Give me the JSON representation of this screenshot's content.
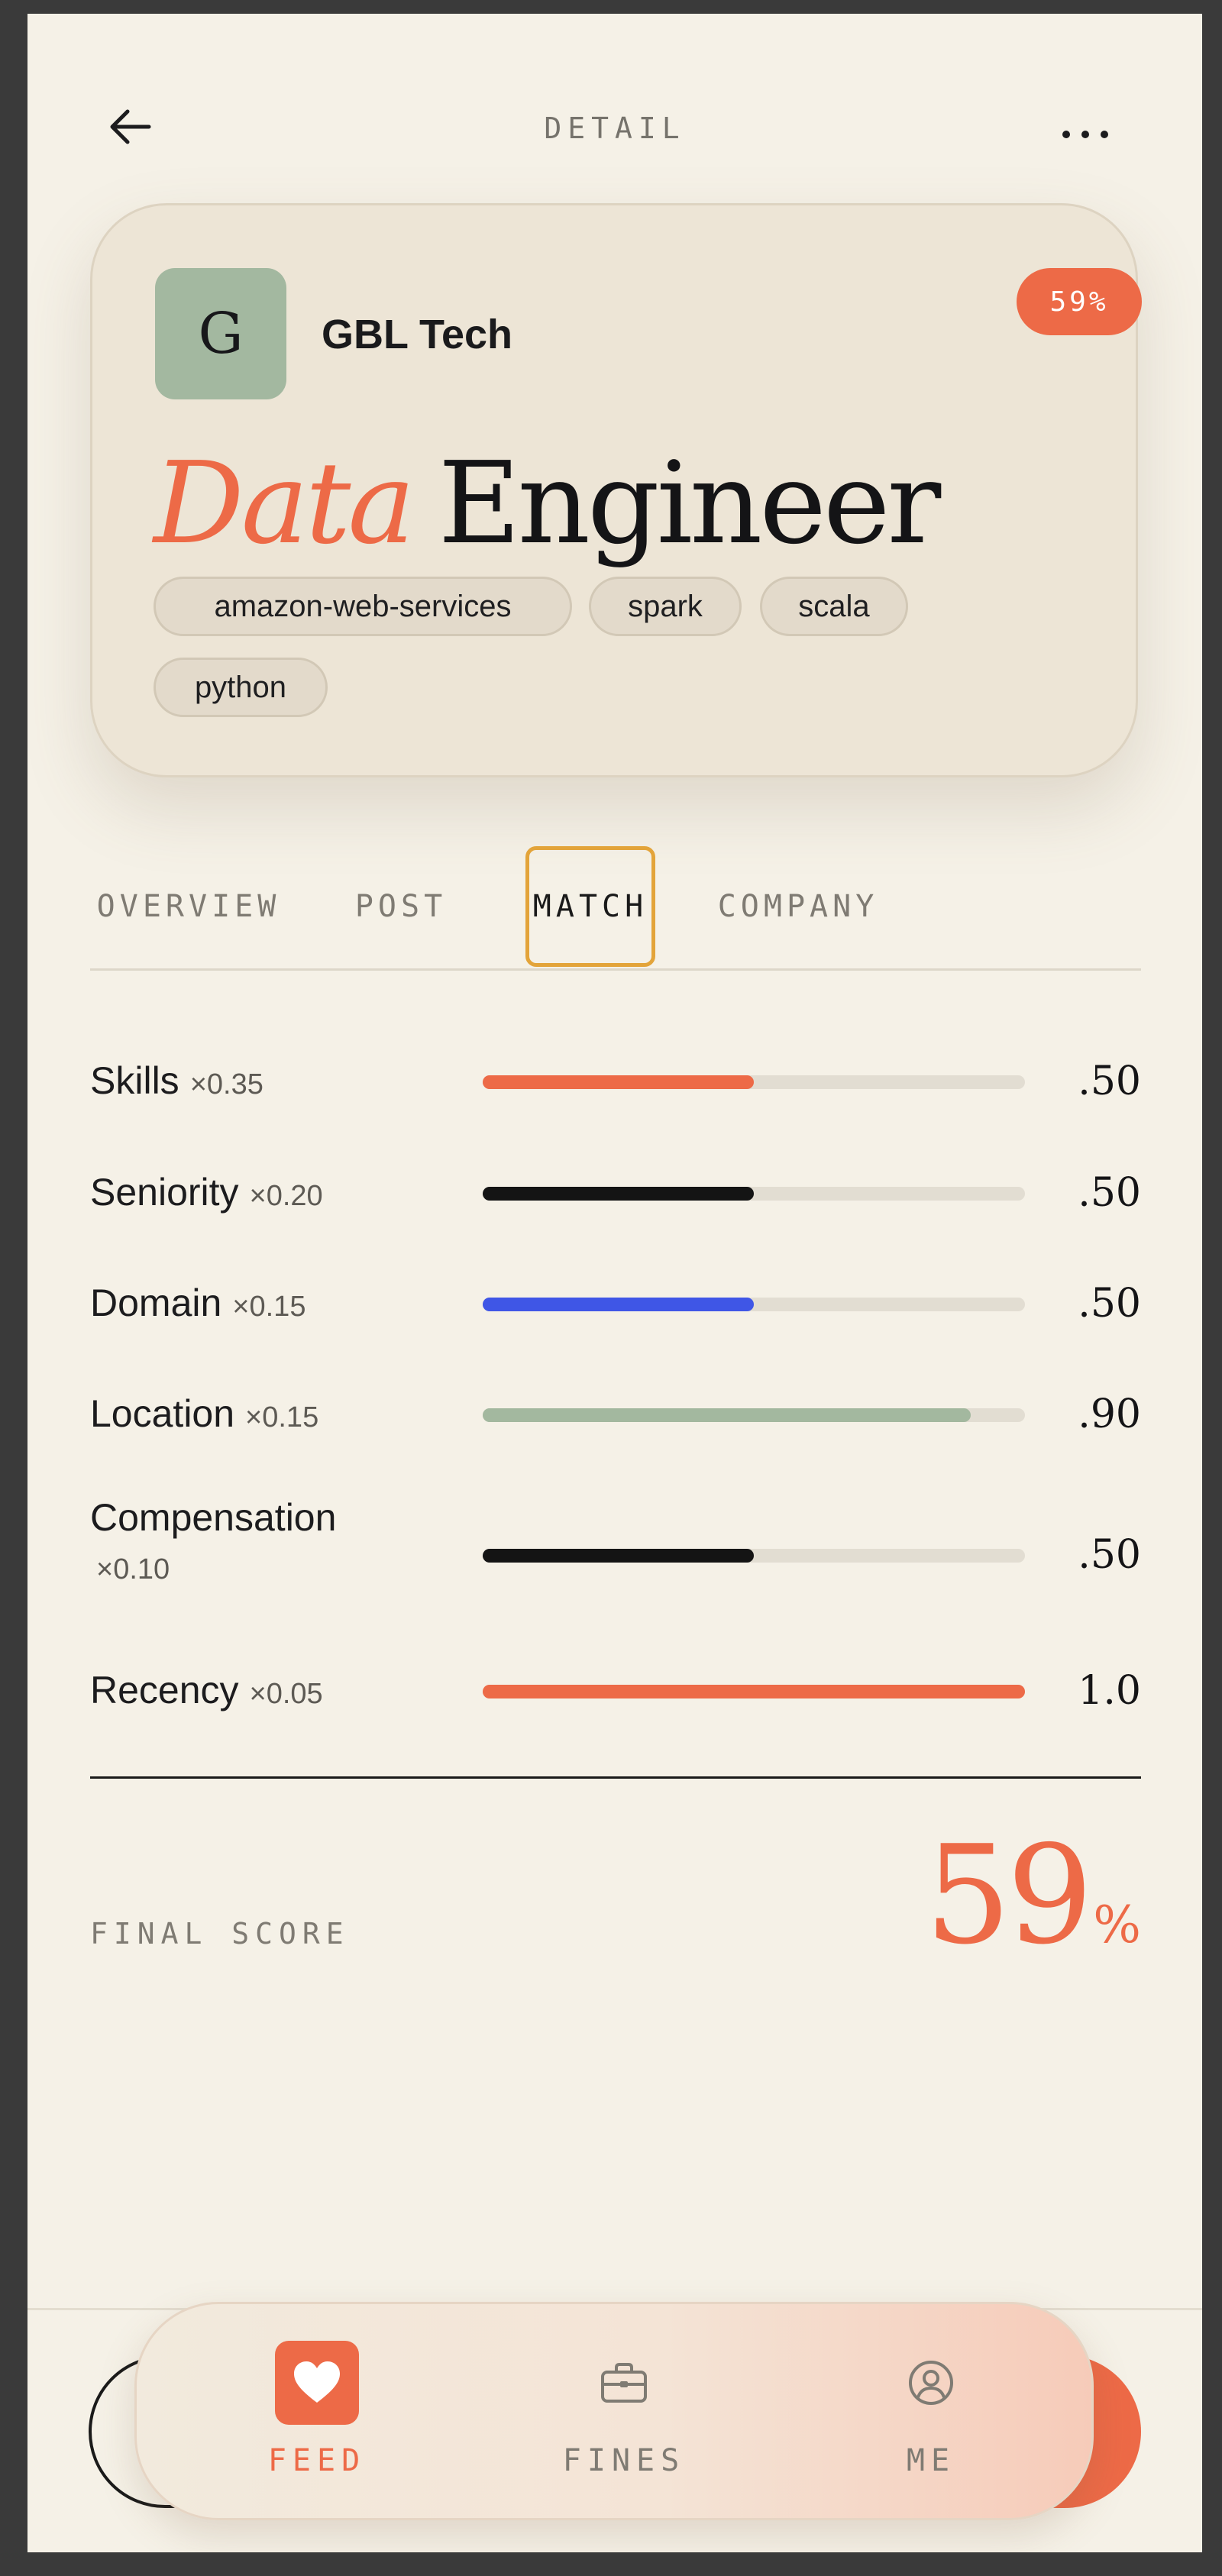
{
  "header": {
    "title": "DETAIL",
    "back_icon": "arrow-left-icon",
    "more_icon": "more-horizontal-icon"
  },
  "job": {
    "company_initial": "G",
    "company": "GBL Tech",
    "score_badge": "59%",
    "title_accent": "Data",
    "title_rest": "Engineer",
    "tags": [
      "amazon-web-services",
      "spark",
      "scala",
      "python"
    ]
  },
  "tabs": [
    {
      "label": "OVERVIEW",
      "active": false
    },
    {
      "label": "POST",
      "active": false
    },
    {
      "label": "MATCH",
      "active": true
    },
    {
      "label": "COMPANY",
      "active": false
    }
  ],
  "match": {
    "metrics": [
      {
        "name": "Skills",
        "weight": "×0.35",
        "value": ".50",
        "fill": 0.5,
        "color": "#ed6a47"
      },
      {
        "name": "Seniority",
        "weight": "×0.20",
        "value": ".50",
        "fill": 0.5,
        "color": "#141414"
      },
      {
        "name": "Domain",
        "weight": "×0.15",
        "value": ".50",
        "fill": 0.5,
        "color": "#3f56e6"
      },
      {
        "name": "Location",
        "weight": "×0.15",
        "value": ".90",
        "fill": 0.9,
        "color": "#a3b89f"
      },
      {
        "name": "Compensation",
        "weight": "×0.10",
        "value": ".50",
        "fill": 0.5,
        "color": "#141414"
      },
      {
        "name": "Recency",
        "weight": "×0.05",
        "value": "1.0",
        "fill": 1.0,
        "color": "#ed6a47"
      }
    ],
    "final_label": "FINAL SCORE",
    "final_score": "59",
    "final_unit": "%"
  },
  "colors": {
    "accent": "#ed6a47",
    "background": "#f5f1e7",
    "card": "#ede5d6",
    "logo": "#a3b8a0",
    "tab_focus": "#e3a43a"
  },
  "nav": [
    {
      "label": "FEED",
      "icon": "heart-icon",
      "active": true
    },
    {
      "label": "FINES",
      "icon": "briefcase-icon",
      "active": false
    },
    {
      "label": "ME",
      "icon": "user-circle-icon",
      "active": false
    }
  ]
}
